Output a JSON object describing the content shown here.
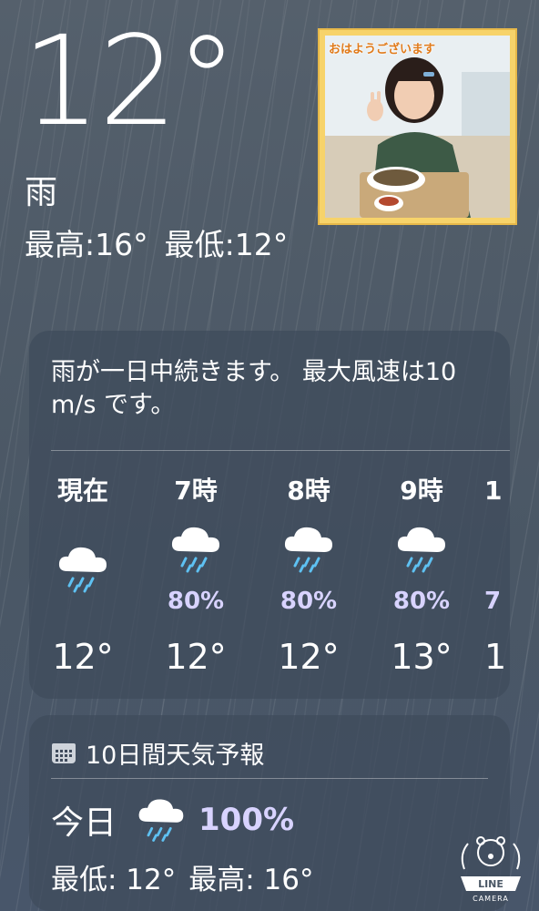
{
  "current": {
    "temperature": "12°",
    "condition": "雨",
    "high": "最高:16°",
    "low": "最低:12°"
  },
  "photo": {
    "caption": "おはようございます"
  },
  "hourly": {
    "summary": "雨が一日中続きます。 最大風速は10 m/s です。",
    "hours": [
      {
        "label": "現在",
        "icon": "rain-cloud-icon",
        "pop": "",
        "temp": "12°"
      },
      {
        "label": "7時",
        "icon": "rain-cloud-icon",
        "pop": "80%",
        "temp": "12°"
      },
      {
        "label": "8時",
        "icon": "rain-cloud-icon",
        "pop": "80%",
        "temp": "12°"
      },
      {
        "label": "9時",
        "icon": "rain-cloud-icon",
        "pop": "80%",
        "temp": "13°"
      },
      {
        "label": "1",
        "icon": "rain-cloud-icon",
        "pop": "7",
        "temp": "1"
      }
    ]
  },
  "forecast": {
    "header": "10日間天気予報",
    "header_icon": "calendar-icon",
    "today": {
      "label": "今日",
      "icon": "rain-cloud-icon",
      "pop": "100%",
      "low": "最低: 12°",
      "high": "最高: 16°"
    }
  },
  "watermark": {
    "line1": "LINE",
    "line2": "CAMERA"
  },
  "colors": {
    "background": "#4f5b68",
    "panel": "#3f4b5c",
    "precip_text": "#d8d3ff",
    "rain_drops": "#5ec1f2"
  }
}
